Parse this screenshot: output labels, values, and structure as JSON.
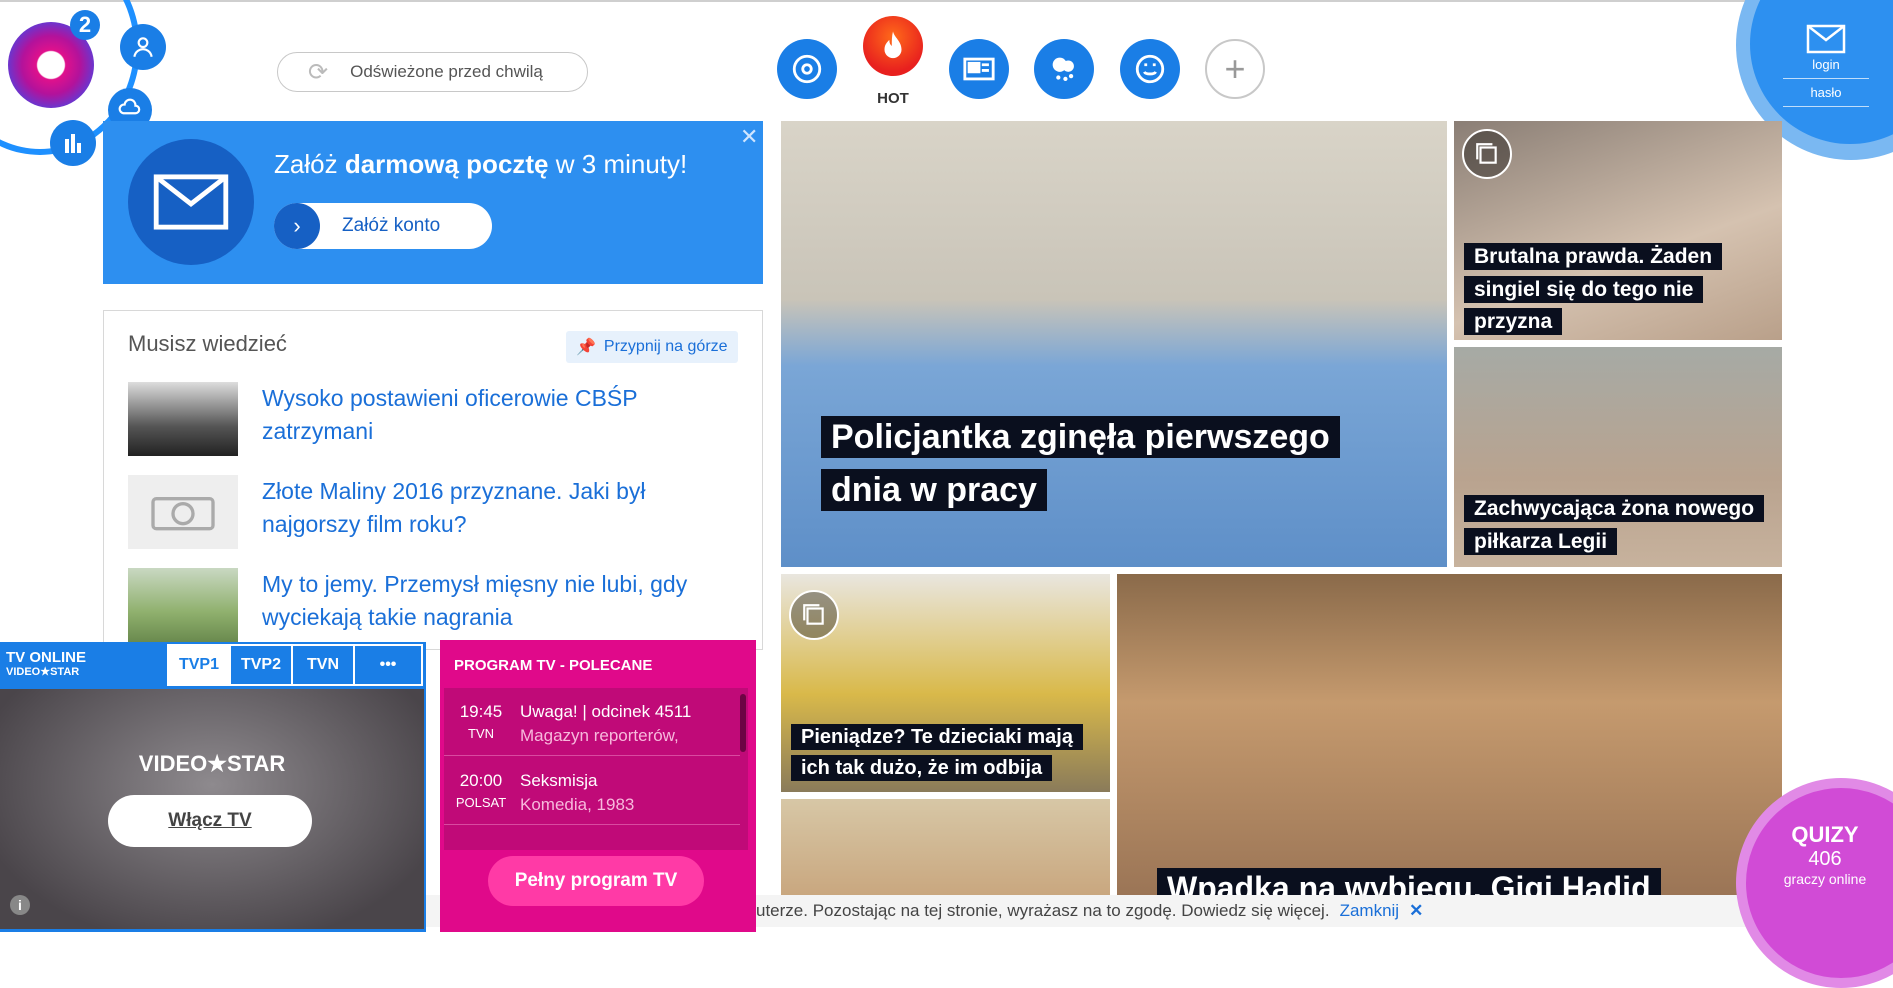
{
  "header": {
    "logo_badge": "2",
    "refresh_text": "Odświeżone przed chwilą",
    "nav": [
      {
        "name": "music",
        "label": ""
      },
      {
        "name": "hot",
        "label": "HOT"
      },
      {
        "name": "news",
        "label": ""
      },
      {
        "name": "weather-cloud",
        "label": ""
      },
      {
        "name": "fun",
        "label": ""
      },
      {
        "name": "add",
        "label": ""
      }
    ],
    "login": {
      "login_label": "login",
      "password_label": "hasło"
    }
  },
  "mail_promo": {
    "text_pre": "Załóż ",
    "text_bold": "darmową pocztę",
    "text_post": " w 3 minuty!",
    "button_label": "Załóż konto"
  },
  "must_know": {
    "title": "Musisz wiedzieć",
    "pin_label": "Przypnij na górze",
    "items": [
      {
        "text": "Wysoko postawieni oficerowie CBŚP zatrzymani"
      },
      {
        "text": "Złote Maliny 2016 przyznane. Jaki był najgorszy film roku?"
      },
      {
        "text": "My to jemy. Przemysł mięsny nie lubi, gdy wyciekają takie nagrania"
      }
    ]
  },
  "stories": {
    "main": "Policjantka zginęła pierwszego dnia w pracy",
    "side1": "Brutalna prawda. Żaden singiel się do tego nie przyzna",
    "side2": "Zachwycająca żona nowego piłkarza Legii",
    "small1": "Pieniądze? Te dzieciaki mają ich tak dużo, że im odbija",
    "large2": "Wpadka na wybiegu. Gigi Hadid"
  },
  "tv": {
    "title": "TV ONLINE",
    "subtitle": "VIDEO★STAR",
    "tabs": [
      "TVP1",
      "TVP2",
      "TVN",
      "•••"
    ],
    "brand": "VIDEO★STAR",
    "button": "Włącz TV",
    "info": "i"
  },
  "program": {
    "title": "PROGRAM TV - POLECANE",
    "rows": [
      {
        "time": "19:45",
        "channel": "TVN",
        "name": "Uwaga! | odcinek 4511",
        "sub": "Magazyn reporterów,"
      },
      {
        "time": "20:00",
        "channel": "POLSAT",
        "name": "Seksmisja",
        "sub": "Komedia, 1983"
      }
    ],
    "button": "Pełny program TV"
  },
  "cookie": {
    "text": "uterze. Pozostając na tej stronie, wyrażasz na to zgodę. Dowiedz się więcej.",
    "close": "Zamknij"
  },
  "quiz": {
    "title": "QUIZY",
    "count": "406",
    "sub": "graczy online"
  }
}
